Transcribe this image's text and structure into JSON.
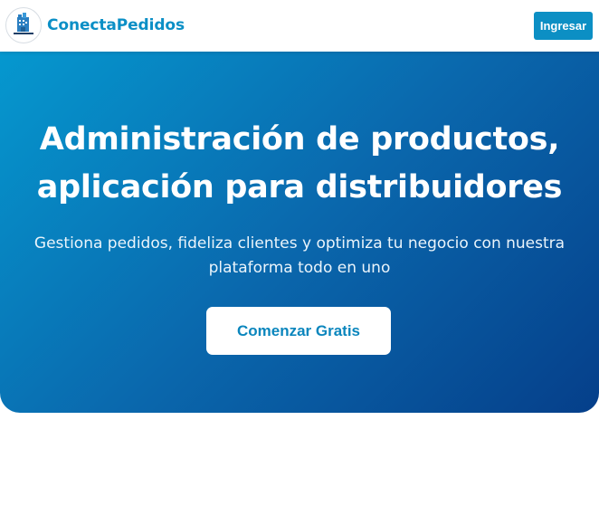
{
  "navbar": {
    "brand_name": "ConectaPedidos",
    "logo_icon": "warehouse-logo-icon",
    "login_label": "Ingresar"
  },
  "hero": {
    "title": "Administración de productos, aplicación para distribuidores",
    "subtitle": "Gestiona pedidos, fideliza clientes y optimiza tu negocio con nuestra plataforma todo en uno",
    "cta_label": "Comenzar Gratis"
  },
  "colors": {
    "brand": "#0b8fc6",
    "hero_gradient_start": "#0598cf",
    "hero_gradient_end": "#053f8a",
    "button_bg": "#0c8fc4"
  }
}
